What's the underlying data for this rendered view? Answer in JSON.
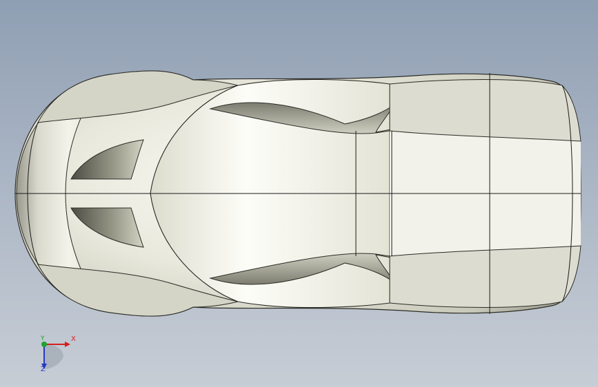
{
  "viewport": {
    "background_top": "#8f9fb3",
    "background_bottom": "#c7cdd5"
  },
  "model": {
    "name": "car-body",
    "view": "top",
    "surface_color": "#e6e6da",
    "edge_color": "#1a1a1a"
  },
  "triad": {
    "x_label": "X",
    "y_label": "Y",
    "z_label": "Z",
    "x_color": "#d11f1f",
    "y_color": "#1ea22e",
    "z_color": "#2637c7"
  }
}
